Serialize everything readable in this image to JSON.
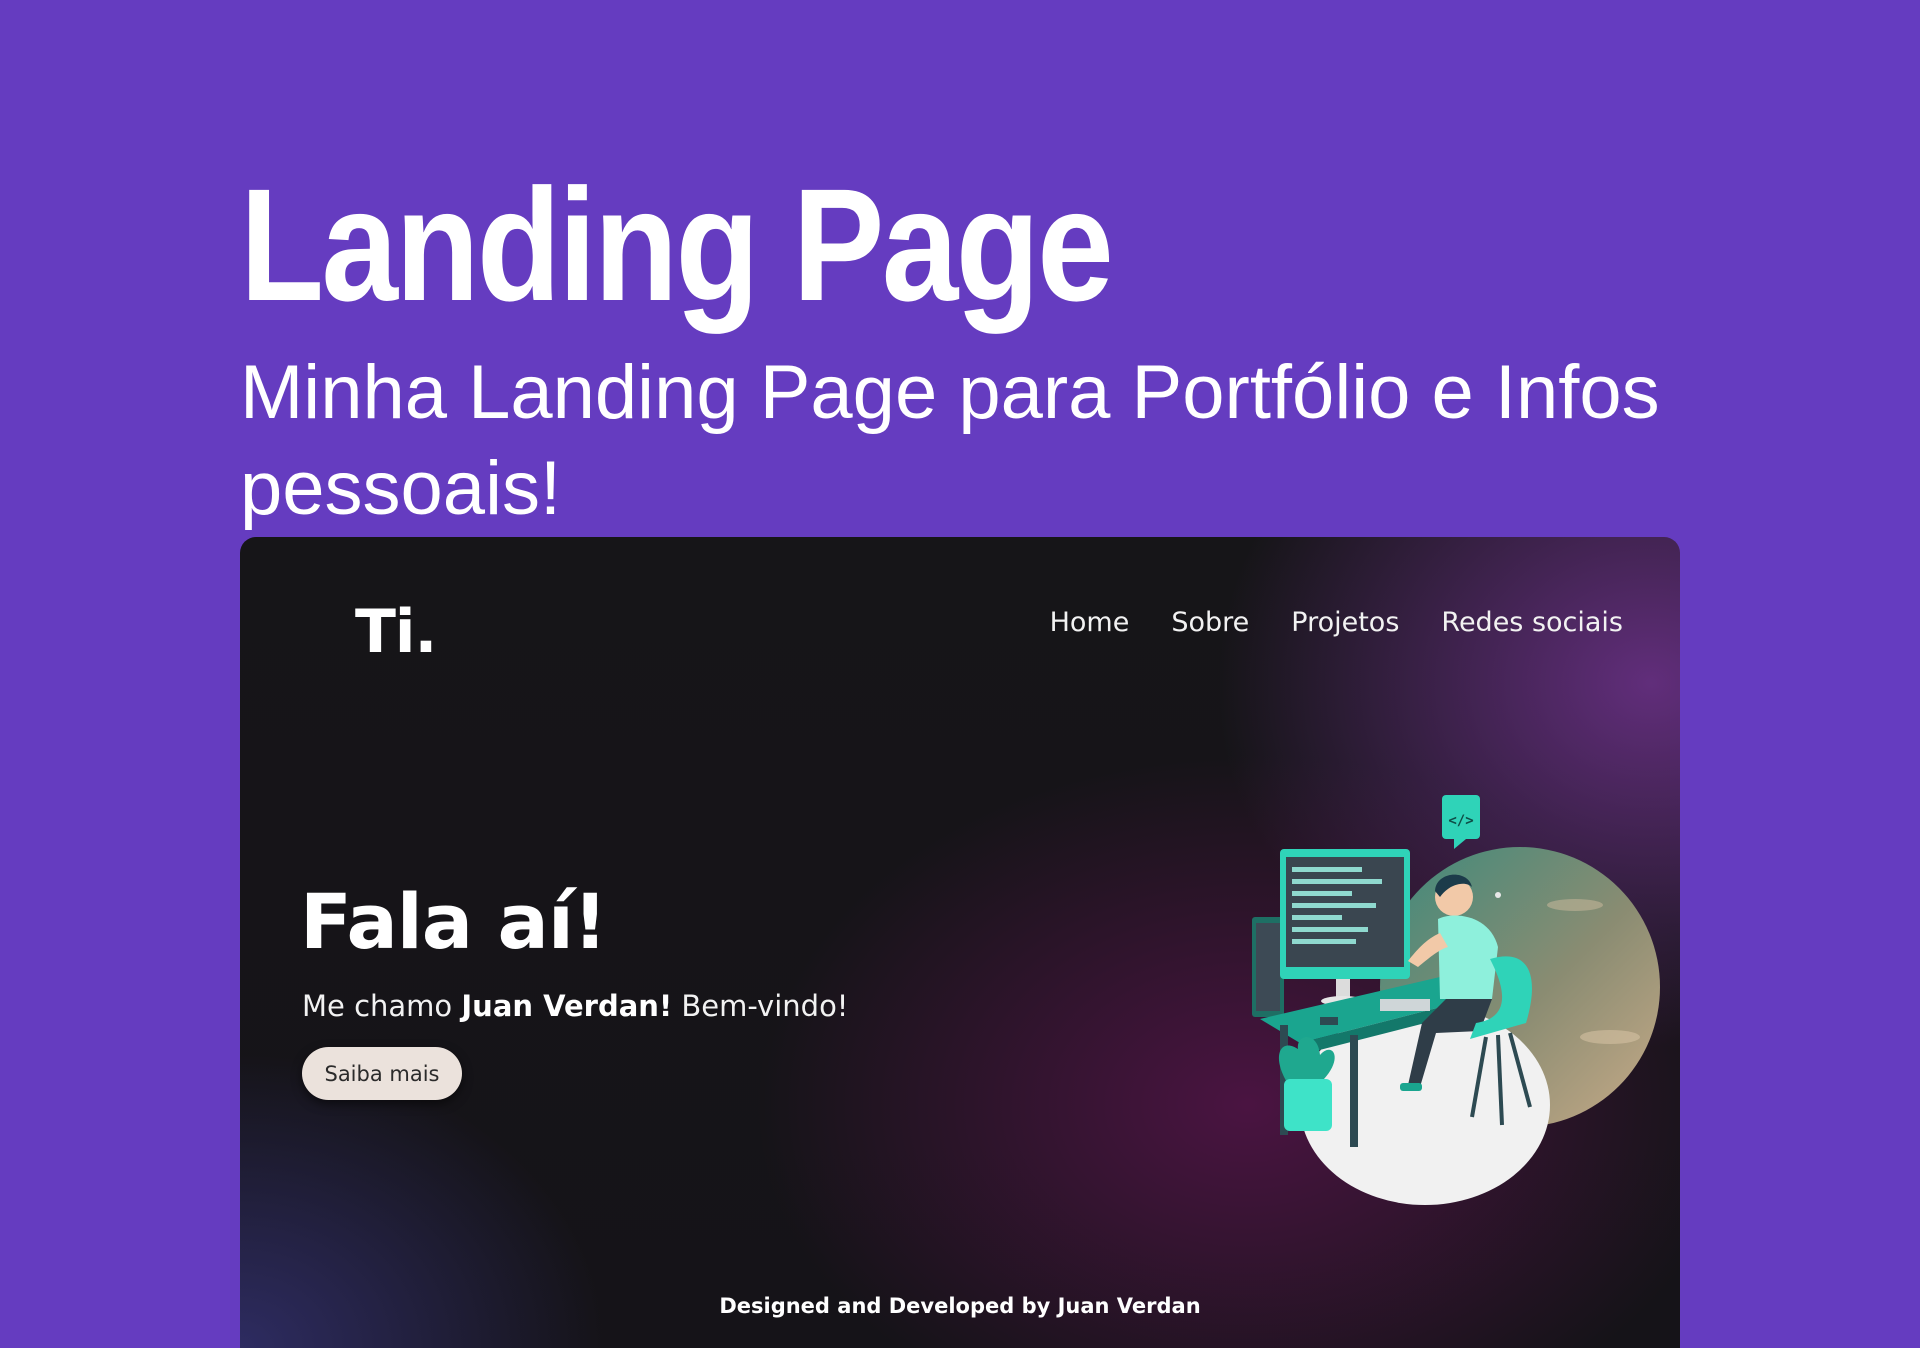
{
  "header": {
    "title": "Landing Page",
    "subtitle": "Minha Landing Page para Portfólio e Infos pessoais!"
  },
  "preview": {
    "logo": "Ti.",
    "nav": [
      {
        "label": "Home"
      },
      {
        "label": "Sobre"
      },
      {
        "label": "Projetos"
      },
      {
        "label": "Redes sociais"
      }
    ],
    "greeting": "Fala aí!",
    "intro_prefix": "Me chamo ",
    "intro_name": "Juan Verdan!",
    "intro_suffix": " Bem-vindo!",
    "cta_label": "Saiba mais",
    "footer": "Designed and Developed by Juan Verdan",
    "illustration_icon": "developer-at-desk-illustration"
  },
  "colors": {
    "page_background": "#653cc0",
    "accent_teal": "#2fd3b8",
    "button_background": "#ebe2dc"
  }
}
